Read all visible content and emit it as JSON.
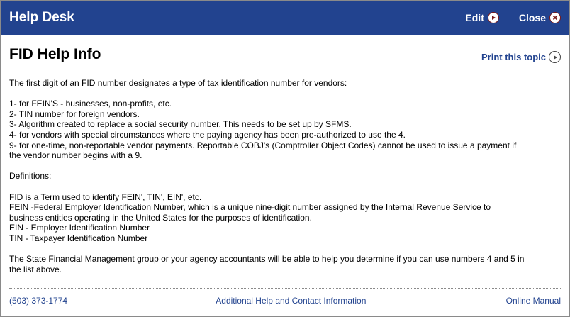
{
  "header": {
    "title": "Help Desk",
    "edit_label": "Edit",
    "close_label": "Close",
    "background": "#22438f"
  },
  "main": {
    "heading": "FID Help Info",
    "print_label": "Print this topic",
    "lines": [
      "The first digit of an FID number designates a type of tax identification number for vendors:",
      "",
      "1- for FEIN'S - businesses, non-profits, etc.",
      "2- TIN number for foreign vendors.",
      "3- Algorithm created to replace a social security number. This needs to be set up by SFMS.",
      "4- for vendors with special circumstances where the paying agency has been pre-authorized to use the 4.",
      "9- for one-time, non-reportable vendor payments. Reportable COBJ's (Comptroller Object Codes) cannot be used to issue a payment if",
      "the vendor number begins with a 9.",
      "",
      "Definitions:",
      "",
      "FID is a Term used to identify FEIN', TIN', EIN', etc.",
      "FEIN -Federal Employer Identification Number, which is a unique nine-digit number assigned by the Internal Revenue Service to",
      "business entities operating in the United States for the purposes of identification.",
      "EIN - Employer Identification Number",
      "TIN - Taxpayer Identification Number",
      "",
      "The State Financial Management group or your agency accountants will be able to help you determine if you can use numbers 4 and 5 in",
      "the list above."
    ]
  },
  "footer": {
    "phone": "(503) 373-1774",
    "contact_link": "Additional Help and Contact Information",
    "manual_link": "Online Manual"
  },
  "icons": {
    "edit": "play-circle-icon",
    "close": "close-circle-icon",
    "print": "play-circle-icon"
  }
}
